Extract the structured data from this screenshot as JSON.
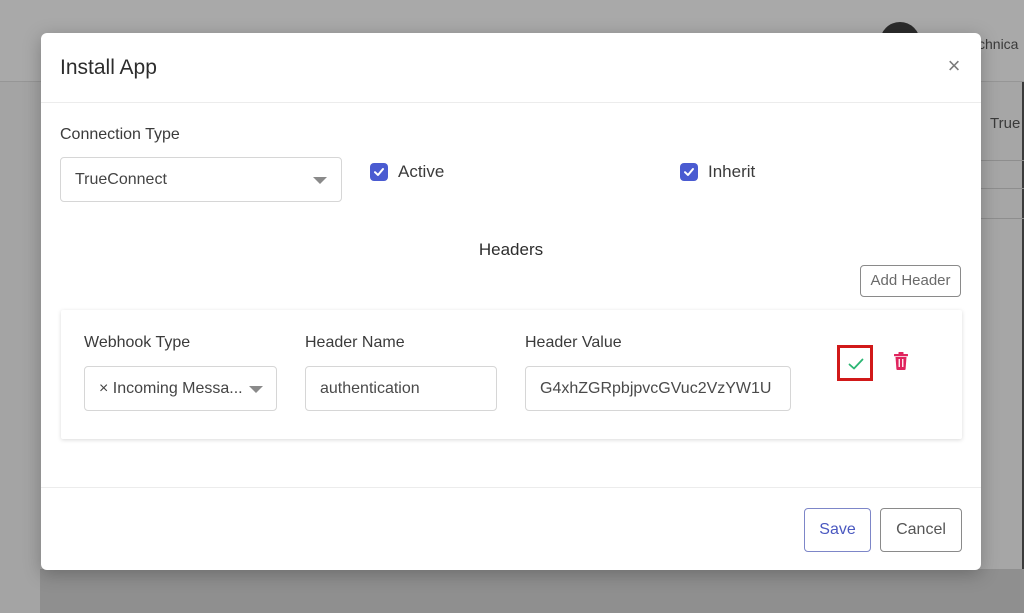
{
  "background": {
    "user_name": "chnica",
    "table_cell": "True"
  },
  "modal": {
    "title": "Install App",
    "close_glyph": "×",
    "connection_type": {
      "label": "Connection Type",
      "value": "TrueConnect"
    },
    "active": {
      "label": "Active",
      "checked": true
    },
    "inherit": {
      "label": "Inherit",
      "checked": true
    },
    "headers_title": "Headers",
    "add_header_label": "Add Header",
    "header_row": {
      "webhook_type_label": "Webhook Type",
      "webhook_type_value": "× Incoming Messa...",
      "header_name_label": "Header Name",
      "header_name_value": "authentication",
      "header_value_label": "Header Value",
      "header_value_value": "G4xhZGRpbjpvcGVuc2VzYW1U"
    },
    "save_label": "Save",
    "cancel_label": "Cancel"
  },
  "colors": {
    "accent": "#4a5bd1",
    "confirm_check": "#2bb673",
    "delete": "#e0245e",
    "highlight_border": "#d11919"
  },
  "icons": {
    "close": "close-icon",
    "checkbox": "check-icon",
    "confirm": "checkmark-icon",
    "delete": "trash-icon",
    "dropdown": "chevron-down-icon"
  }
}
